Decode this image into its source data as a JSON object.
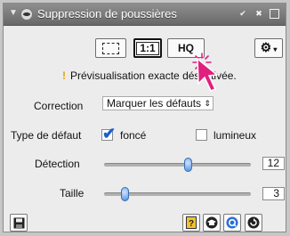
{
  "window": {
    "title": "Suppression de poussières",
    "controls": {
      "check": "✔",
      "close": "✖"
    }
  },
  "toolbar": {
    "preview_full_icon": "preview-frame-icon",
    "one_to_one_label": "1:1",
    "hq_label": "HQ",
    "options_icon": "gear-icon"
  },
  "warning": {
    "icon": "!",
    "text": "Prévisualisation exacte désactivée."
  },
  "correction": {
    "label": "Correction",
    "selected": "Marquer les défauts",
    "arrow": "⇕"
  },
  "defect_type": {
    "label": "Type de défaut",
    "options": [
      {
        "label": "foncé",
        "checked": true
      },
      {
        "label": "lumineux",
        "checked": false
      }
    ]
  },
  "detection": {
    "label": "Détection",
    "value": "12",
    "fraction": 0.58
  },
  "size": {
    "label": "Taille",
    "value": "3",
    "fraction": 0.12
  },
  "bottom_buttons": {
    "save_icon": "save-icon",
    "help_icon": "help-icon",
    "school_icon": "graduation-cap-icon",
    "q_icon": "quality-icon",
    "reset_icon": "reset-icon"
  },
  "colors": {
    "accent": "#1a5fd1",
    "cursor": "#e0207e",
    "warning": "#e3a300"
  }
}
